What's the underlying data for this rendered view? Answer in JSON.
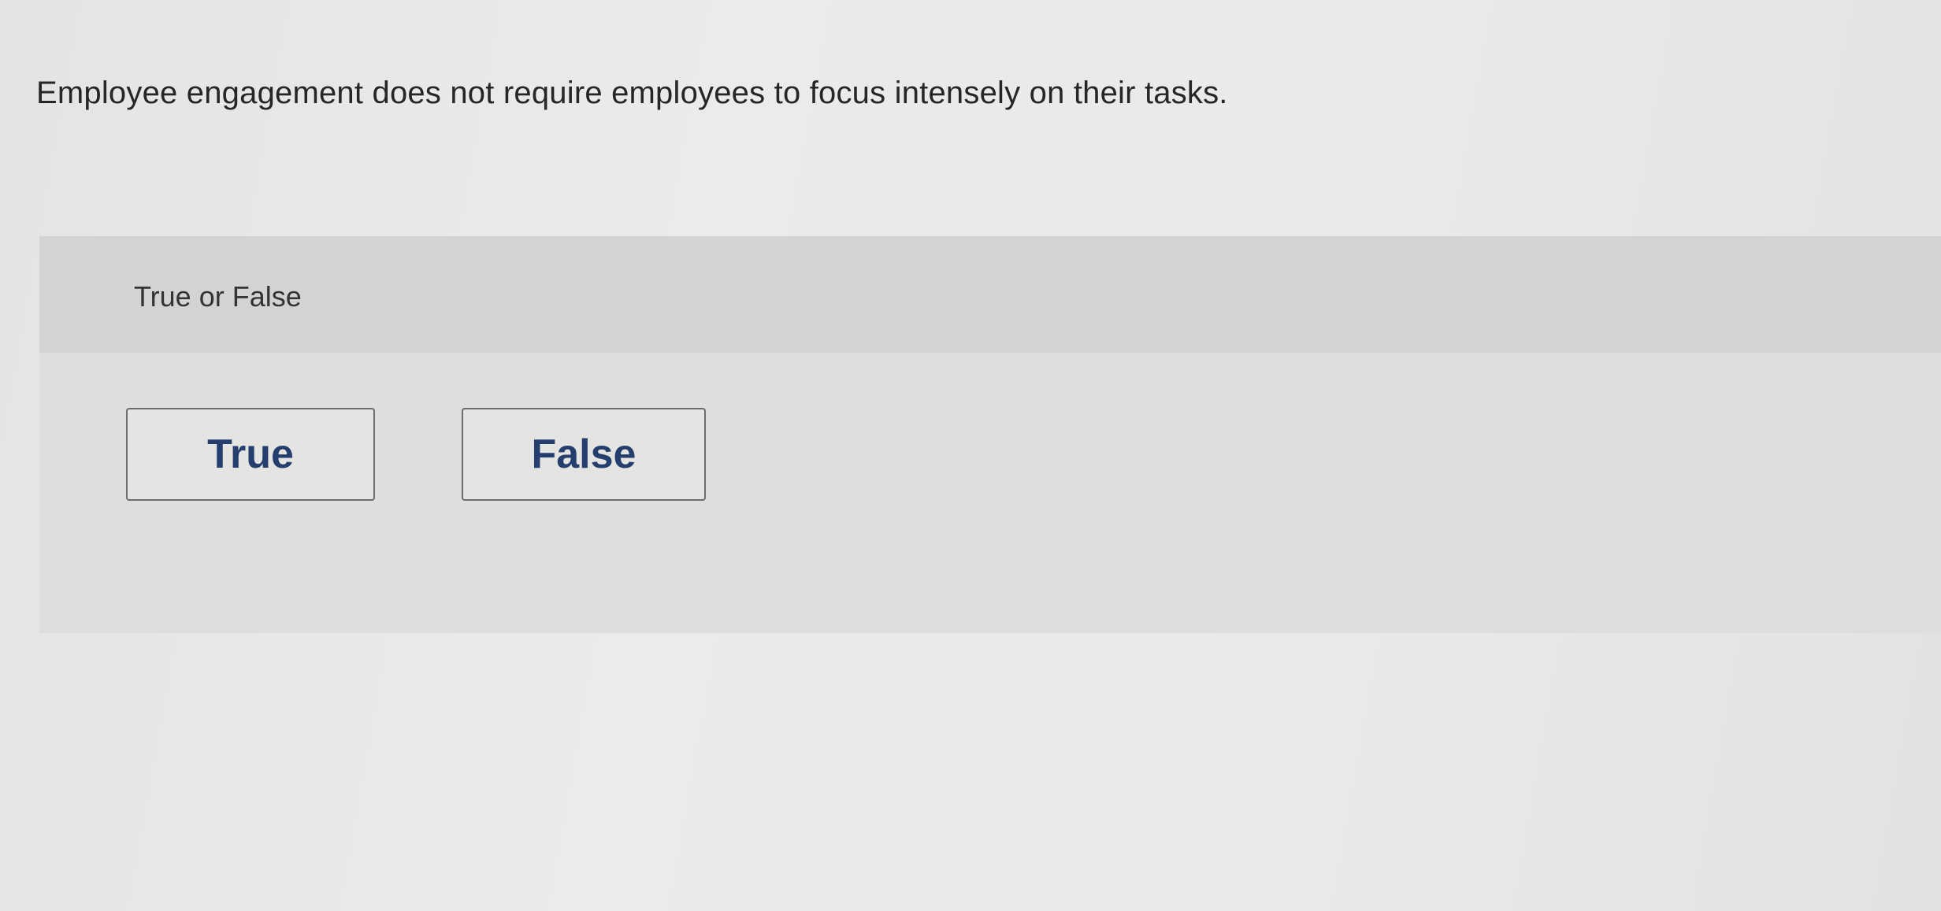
{
  "question": {
    "text": "Employee engagement does not require employees to focus intensely on their tasks."
  },
  "answer_panel": {
    "prompt": "True or False",
    "choices": [
      {
        "label": "True"
      },
      {
        "label": "False"
      }
    ]
  },
  "colors": {
    "background": "#e8e8e6",
    "panel": "#dededc",
    "panel_header": "#d3d3d1",
    "button_text": "#243e6e",
    "button_border": "#6c6c6c"
  }
}
